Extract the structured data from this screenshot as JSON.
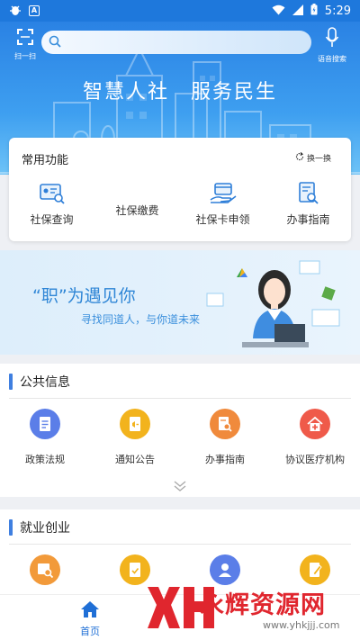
{
  "status_bar": {
    "time": "5:29",
    "left_icons": [
      "bug-icon",
      "text-a-icon"
    ],
    "right_icons": [
      "wifi-icon",
      "signal-icon",
      "battery-icon"
    ]
  },
  "header": {
    "scan_label": "扫一扫",
    "search_placeholder": "",
    "voice_label": "语音搜索",
    "slogan": "智慧人社　服务民生"
  },
  "common_functions": {
    "title": "常用功能",
    "refresh_label": "换一换",
    "items": [
      {
        "label": "社保查询",
        "icon": "id-card-search-icon"
      },
      {
        "label": "社保缴费",
        "icon": ""
      },
      {
        "label": "社保卡申领",
        "icon": "card-hand-icon"
      },
      {
        "label": "办事指南",
        "icon": "guide-search-icon"
      }
    ]
  },
  "banner": {
    "headline": "“职”为遇见你",
    "subtitle": "寻找同道人，与你道未来"
  },
  "public_info": {
    "title": "公共信息",
    "items": [
      {
        "label": "政策法规",
        "icon": "policy-doc-icon",
        "color": "#5b7ee8"
      },
      {
        "label": "通知公告",
        "icon": "notice-icon",
        "color": "#f2b31d"
      },
      {
        "label": "办事指南",
        "icon": "guide-search-icon",
        "color": "#f08a3c"
      },
      {
        "label": "协议医疗机构",
        "icon": "hospital-icon",
        "color": "#ef5a4a"
      }
    ]
  },
  "employment": {
    "title": "就业创业",
    "items": [
      {
        "label": "",
        "icon": "job-search-icon",
        "color": "#f29a3a"
      },
      {
        "label": "",
        "icon": "resume-icon",
        "color": "#f2b31d"
      },
      {
        "label": "",
        "icon": "user-icon",
        "color": "#5b7ee8"
      },
      {
        "label": "",
        "icon": "edit-doc-icon",
        "color": "#f2b31d"
      }
    ]
  },
  "bottom_nav": {
    "home_label": "首页"
  },
  "watermark": {
    "brand": "永辉资源网",
    "url": "www.yhkjjj.com"
  },
  "colors": {
    "primary": "#1e78dc",
    "accent_bar": "#3f7fe0",
    "watermark_red": "#e0262e"
  }
}
